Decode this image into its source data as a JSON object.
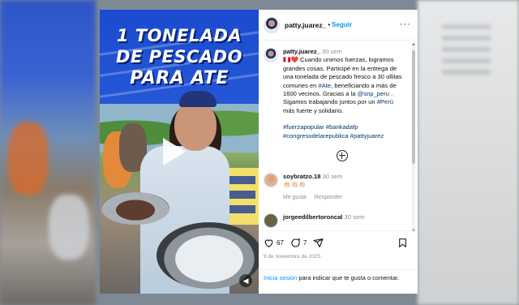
{
  "post": {
    "username": "patty.juarez_",
    "follow_label": "Seguir",
    "more_label": "···",
    "media": {
      "headline": [
        "1 TONELADA",
        "DE PESCADO",
        "PARA ATE"
      ]
    },
    "caption": {
      "username": "patty.juarez_",
      "time": "30 sem",
      "emoji": "🇵🇪❤️",
      "text_1": "Cuando unimos fuerzas, logramos grandes cosas. Participé en la entrega de una tonelada de pescado fresco a 30 ollitas comunes en",
      "link_1": "#Ate",
      "text_2": ", beneficiando a más de 1600 vecinos. Gracias a la",
      "link_2": "@snp_peru",
      "text_3": ". Sigamos trabajando juntos por un",
      "link_3": "#Perú",
      "text_4": "más fuerte y solidario.",
      "hashtags": "#fuerzapopular #bankadafp #congresodelarepublica #pattyjuarez"
    },
    "comments": [
      {
        "username": "soybratzo.18",
        "time": "30 sem",
        "text": "👏🏻👏🏻👏🏻",
        "like_label": "Me gusta",
        "reply_label": "Responder"
      },
      {
        "username": "jorgeedilbertoroncal",
        "time": "30 sem"
      }
    ],
    "likes_count": "67",
    "comments_count": "7",
    "date": "9 de noviembre de 2025",
    "login": {
      "link": "Inicia sesión",
      "text": "para indicar que te gusta o comentar."
    }
  },
  "icons": [
    "heart-icon",
    "comment-icon",
    "share-icon",
    "bookmark-icon",
    "add-comments-icon",
    "play-icon",
    "mute-icon"
  ],
  "colors": {
    "link": "#00376b",
    "follow": "#0095f6",
    "banner": "#1d4ed1"
  }
}
